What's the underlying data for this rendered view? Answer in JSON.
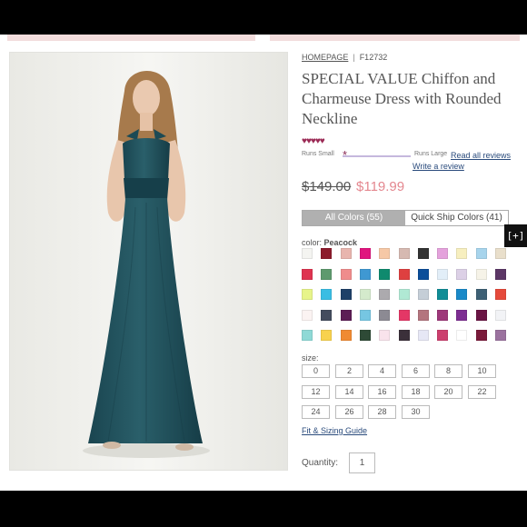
{
  "breadcrumb": {
    "home": "HOMEPAGE",
    "separator": "|",
    "sku": "F12732"
  },
  "product": {
    "title": "SPECIAL VALUE Chiffon and Charmeuse Dress with Rounded Neckline",
    "rating_stars": "♥♥♥♥♥",
    "rating_value": 4.5,
    "old_price": "$149.00",
    "new_price": "$119.99"
  },
  "fit": {
    "small_label": "Runs Small",
    "large_label": "Runs Large",
    "marker": "*",
    "position": 0.0
  },
  "reviews": {
    "read": "Read all reviews",
    "write": "Write a review"
  },
  "tabs": [
    {
      "label": "All Colors (55)",
      "active": true
    },
    {
      "label": "Quick Ship Colors (41)",
      "active": false
    }
  ],
  "expand_button": "[+]",
  "color": {
    "label": "color:",
    "selected": "Peacock"
  },
  "swatches": [
    [
      "#f4f4f1",
      "#8c1c2c",
      "#e8b5ae",
      "#e0157e",
      "#f6c8a6",
      "#d6b9b1",
      "#333333",
      "#e4a2dc",
      "#f7efbf",
      "#a7d4ec",
      "#e9dfcb"
    ],
    [
      "#de3450",
      "#5e9a6e",
      "#ef8c8c",
      "#3f98d2",
      "#0f8a6e",
      "#de4040",
      "#0b4e9a",
      "#e2eef8",
      "#dcd0e6",
      "#f6f3e8",
      "#5c3766"
    ],
    [
      "#e7f48a",
      "#3abde3",
      "#1f4168",
      "#d4eacc",
      "#acaaae",
      "#b0e9d4",
      "#c5ced7",
      "#118d96",
      "#1a89c8",
      "#3d6075",
      "#e54a3b"
    ],
    [
      "#fbf3f2",
      "#444c5e",
      "#5c1d55",
      "#76c6e2",
      "#8c8a93",
      "#e43766",
      "#b4757e",
      "#9e387a",
      "#7d2e92",
      "#6a1544",
      "#f2f3f6"
    ],
    [
      "#8fd9d6",
      "#f8d24e",
      "#f08a32",
      "#2e4a36",
      "#f9e3ec",
      "#3b303a",
      "#e6e7f5",
      "#cc3f6e",
      "#ffffff",
      "#7a1a3a",
      "#9b729f"
    ]
  ],
  "size": {
    "label": "size:",
    "options": [
      "0",
      "2",
      "4",
      "6",
      "8",
      "10",
      "12",
      "14",
      "16",
      "18",
      "20",
      "22",
      "24",
      "26",
      "28",
      "30"
    ]
  },
  "fit_guide": "Fit & Sizing Guide",
  "quantity": {
    "label": "Quantity:",
    "value": "1"
  },
  "colors": {
    "accent_price": "#e4878f",
    "link": "#2a4b7c",
    "stars": "#9b2a55",
    "dress": "#1f4f5a"
  }
}
